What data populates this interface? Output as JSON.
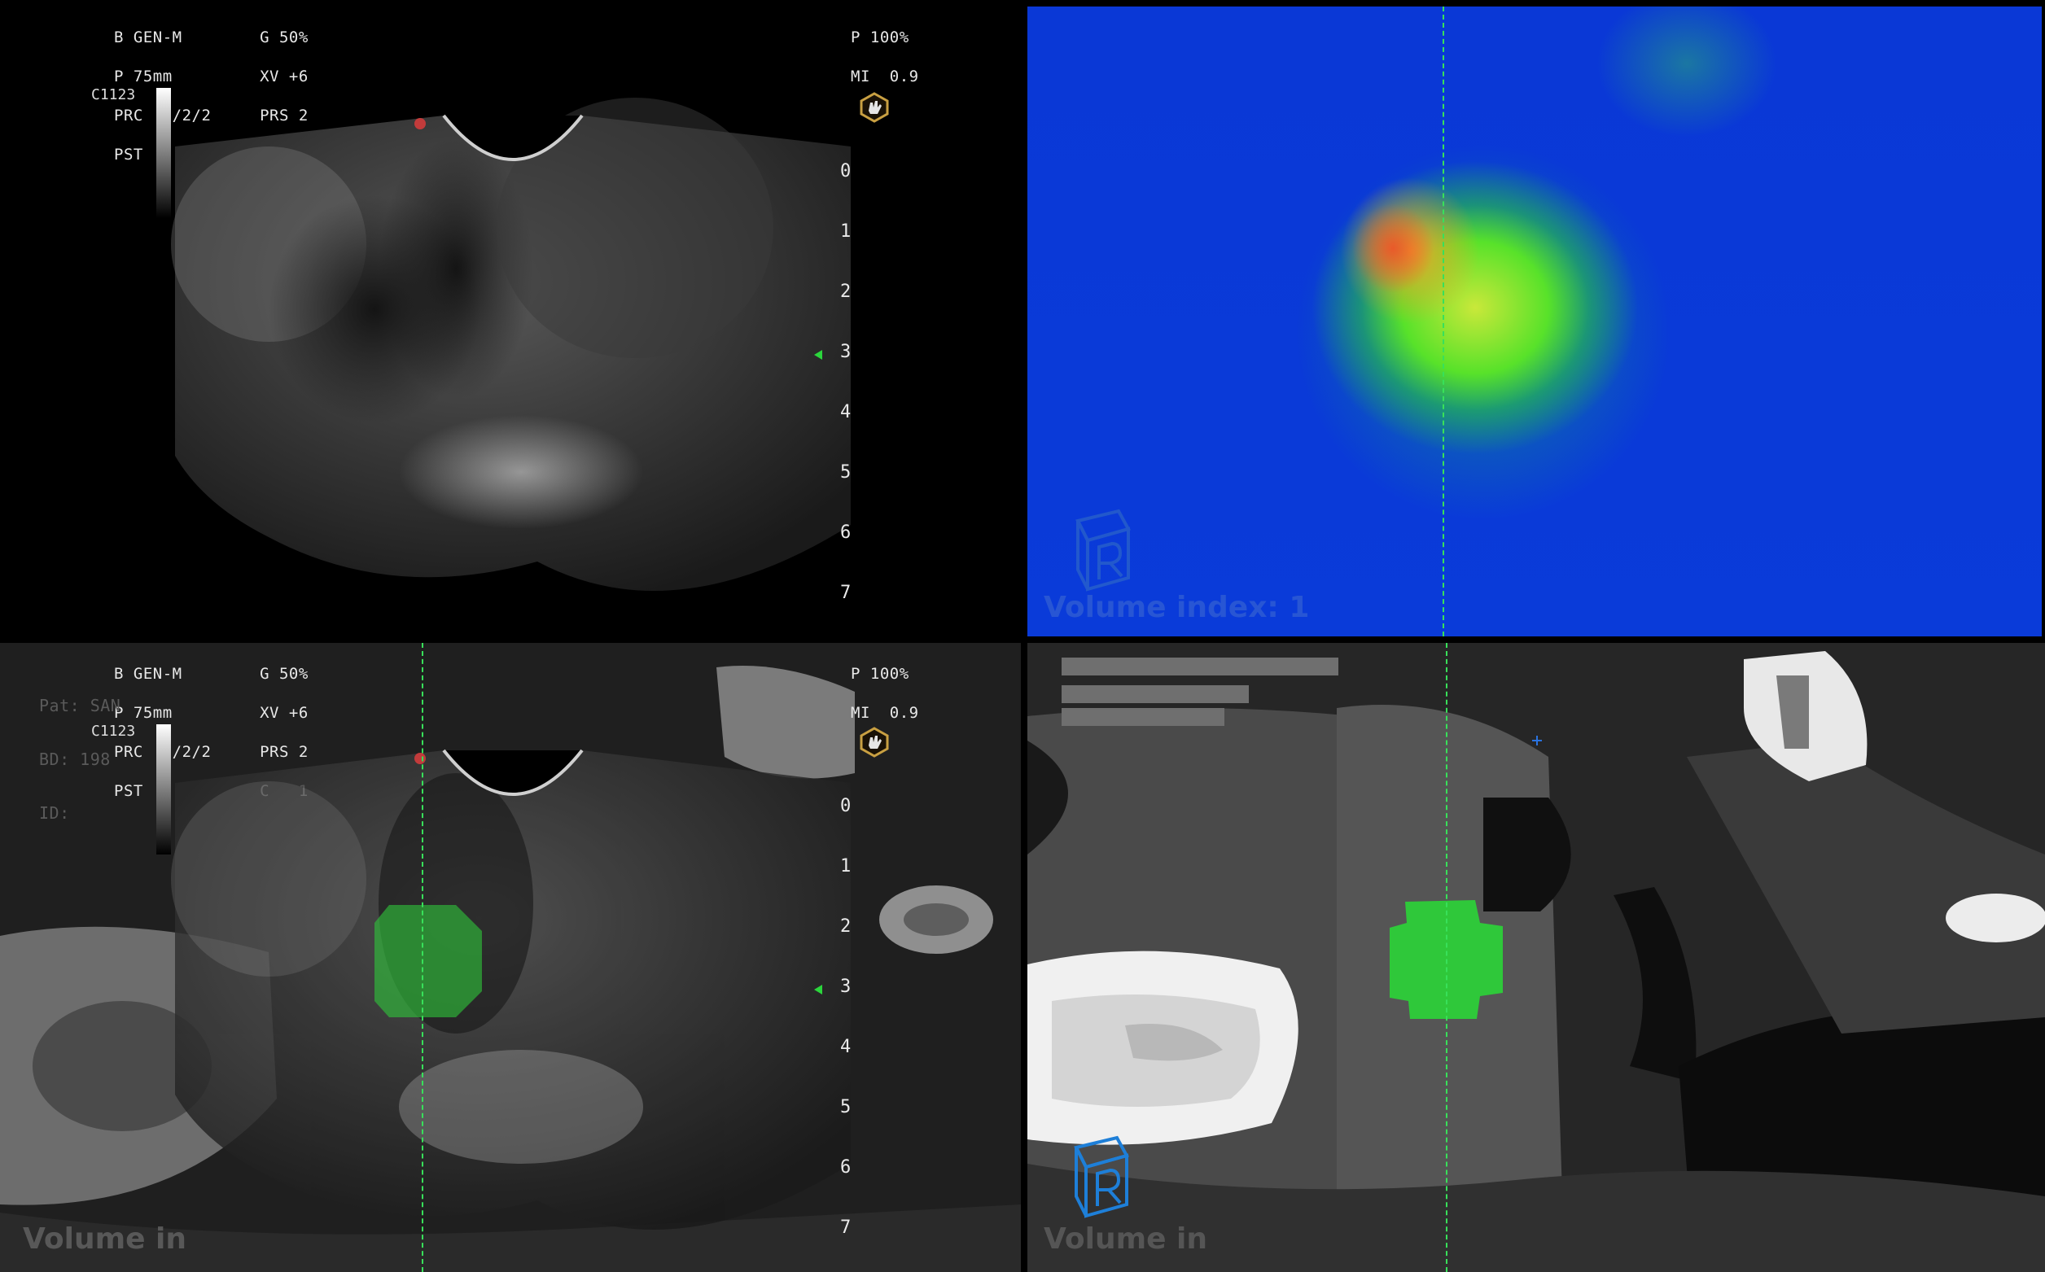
{
  "us_overlay": {
    "line1": "B GEN-M        G 50%",
    "line2": "P 75mm         XV +6",
    "line3": "PRC  8/2/2     PRS 2",
    "line4": "PST  0         C   1",
    "power": "P 100%",
    "mi": "MI  0.9",
    "probe": "C1123"
  },
  "depth_marks": [
    "0",
    "1",
    "2",
    "3",
    "4",
    "5",
    "6",
    "7"
  ],
  "patient_overlay": {
    "pat": "Pat: SAN",
    "bd": "BD: 198",
    "id": "ID:"
  },
  "watermarks": {
    "top_right": "Volume index: 1",
    "bottom_left": "Volume in",
    "bottom_right": "Volume in"
  },
  "colors": {
    "crosshair": "#38e05a",
    "segmentation": "#2fc83a",
    "heatmap_base": "#0a3bd9",
    "logo": "#1e7fd8"
  },
  "icons": {
    "probe_marker": "hexagon-hand-icon",
    "logo": "r-cube-logo-icon"
  }
}
